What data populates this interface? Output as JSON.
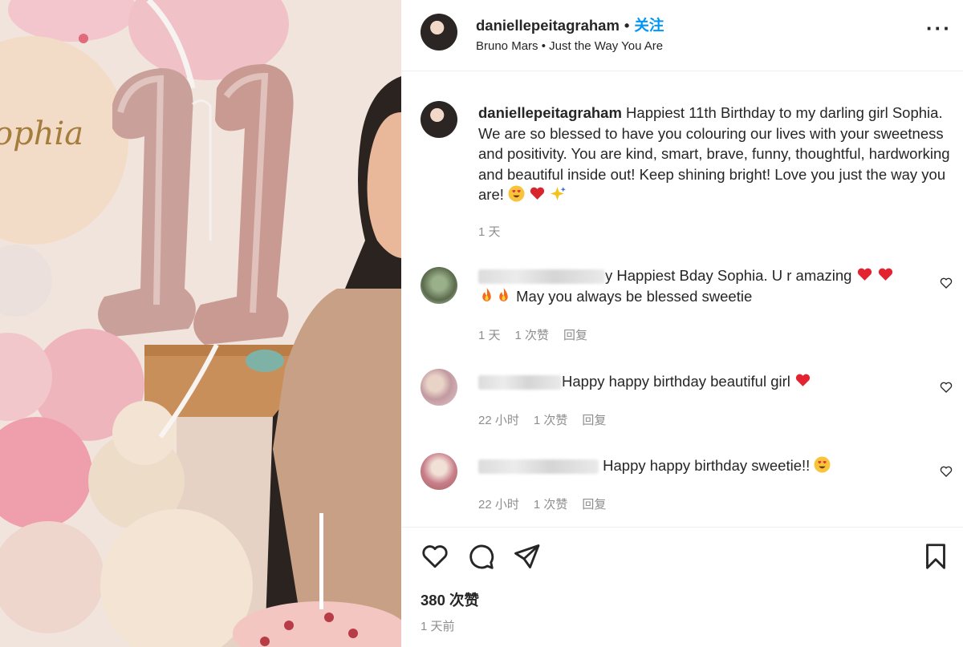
{
  "post": {
    "username": "daniellepeitagraham",
    "dot": "•",
    "follow_label": "关注",
    "song": "Bruno Mars • Just the Way You Are",
    "more_icon": "more-horizontal-icon",
    "balloon_text": "ophia",
    "number_balloon": "11"
  },
  "caption": {
    "username": "daniellepeitagraham",
    "text": "Happiest 11th Birthday to my darling girl Sophia. We are so blessed to have you colouring our lives with your sweetness and positivity. You are kind, smart, brave, funny, thoughtful, hardworking and beautiful inside out! Keep shining bright! Love you just the way you are!",
    "emojis": [
      "heart-eyes-emoji",
      "heart-emoji",
      "sparkles-emoji"
    ],
    "time": "1 天"
  },
  "comments": [
    {
      "visible_start": "y",
      "text": "Happiest Bday Sophia. U r amazing",
      "emojis_inline": [
        "red-heart",
        "red-heart"
      ],
      "line2_emojis": [
        "fire",
        "fire"
      ],
      "line2_text": "May you always be blessed sweetie",
      "time": "1 天",
      "likes": "1 次赞",
      "reply": "回复"
    },
    {
      "visible_start": "H",
      "text": "appy happy birthday beautiful girl",
      "emojis_inline": [
        "red-heart"
      ],
      "time": "22 小时",
      "likes": "1 次赞",
      "reply": "回复"
    },
    {
      "visible_start": "",
      "text": "Happy happy birthday sweetie!!",
      "emojis_inline": [
        "heart-eyes"
      ],
      "time": "22 小时",
      "likes": "1 次赞",
      "reply": "回复"
    }
  ],
  "footer": {
    "likes": "380 次赞",
    "posted": "1 天前"
  },
  "colors": {
    "follow": "#0095f6",
    "muted": "#8e8e8e",
    "text": "#262626"
  }
}
